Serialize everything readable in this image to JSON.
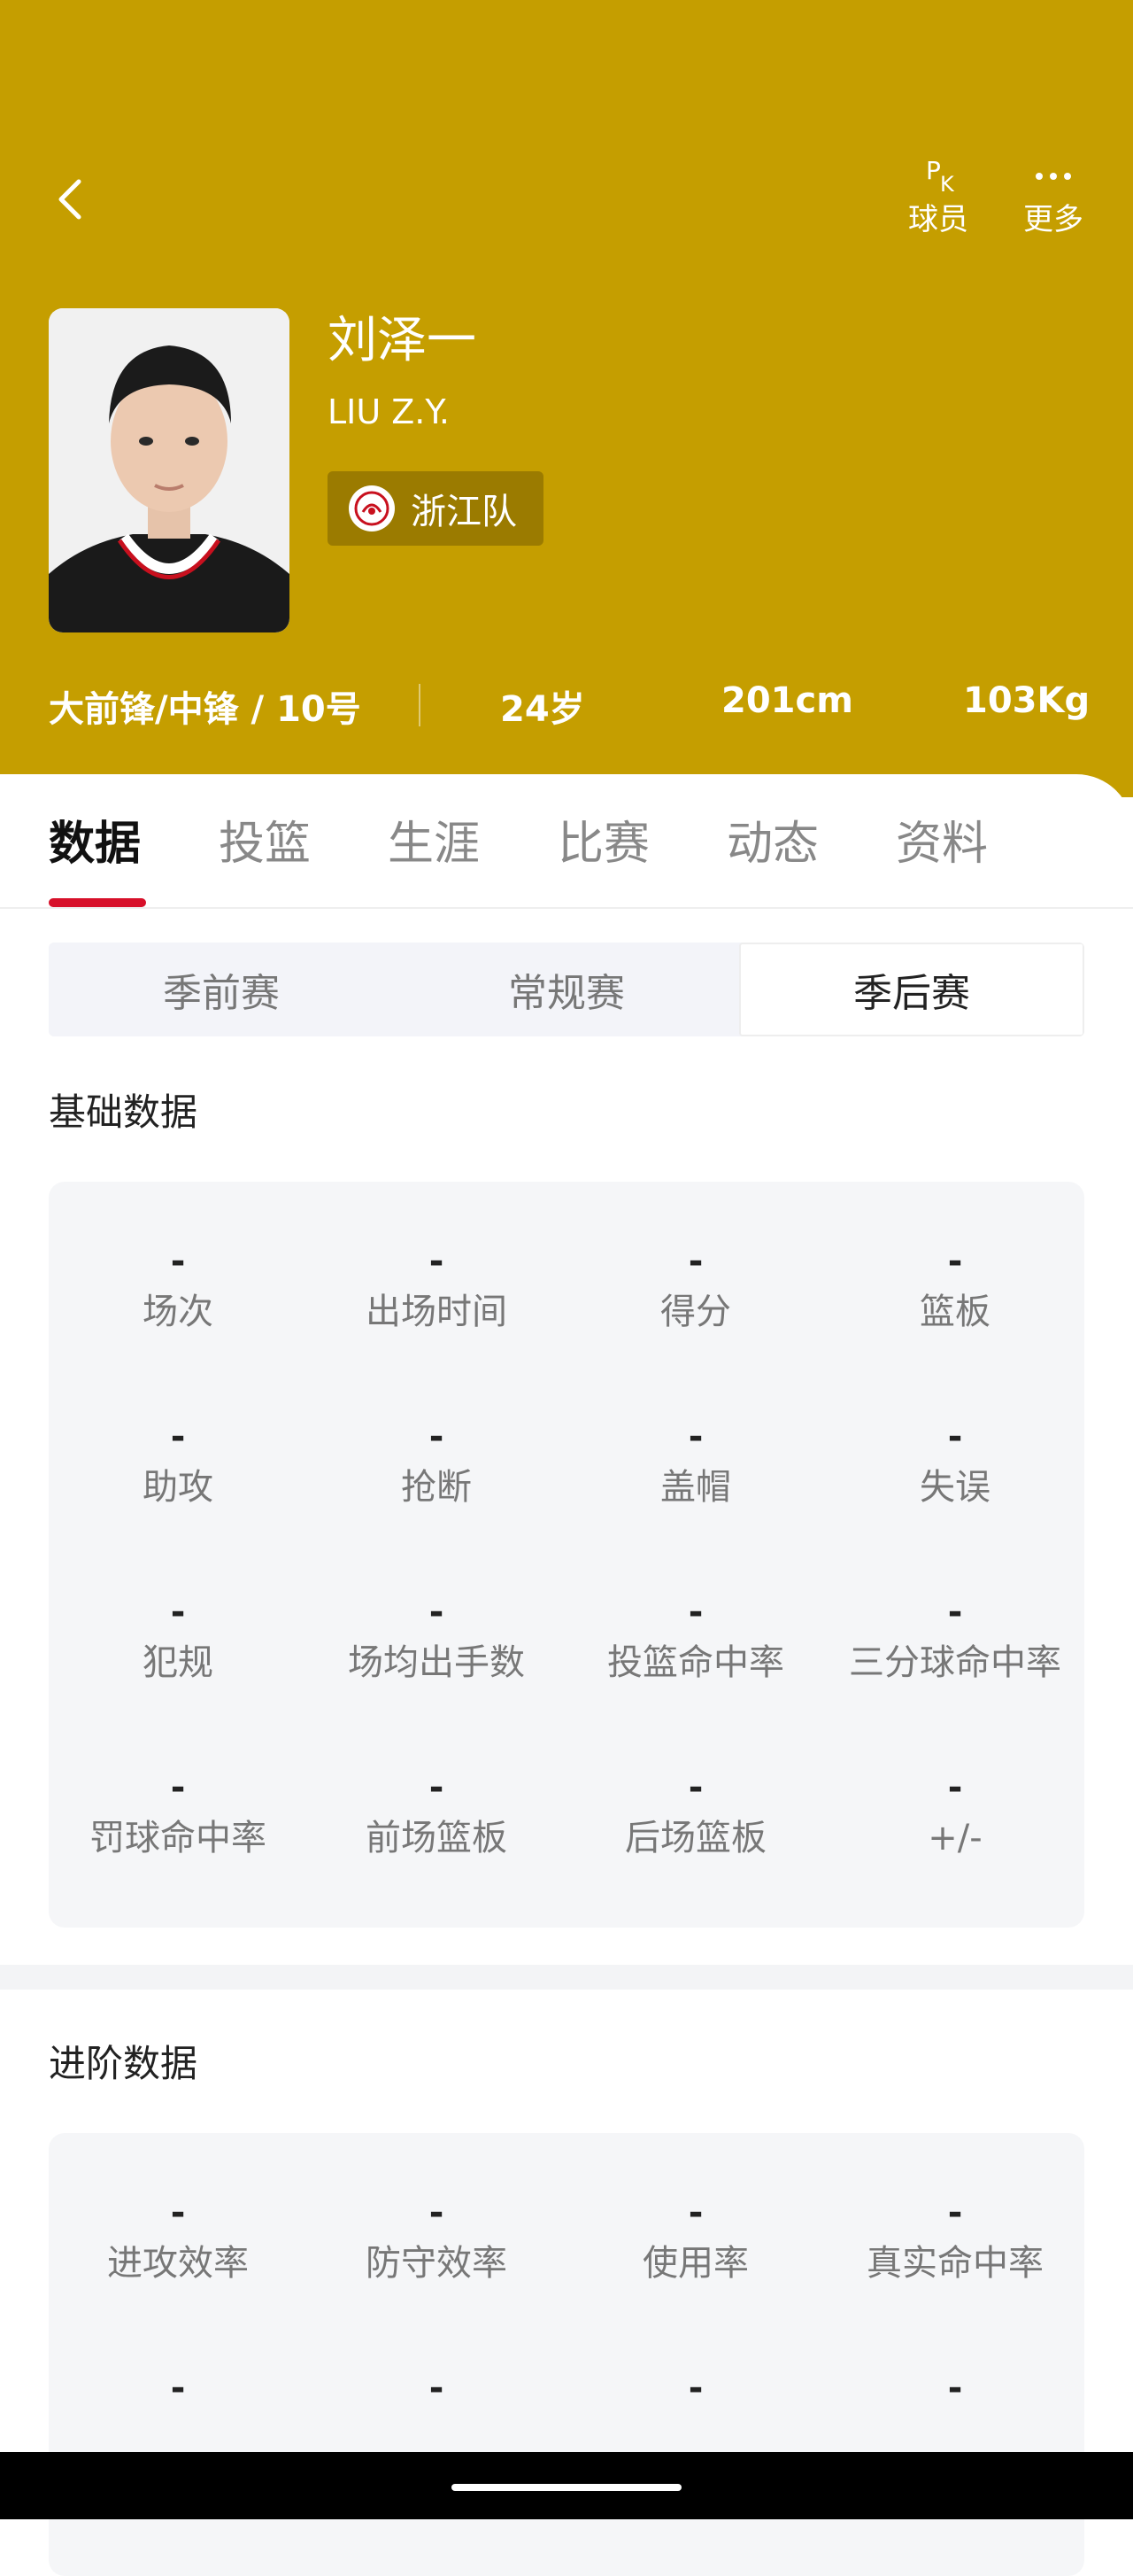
{
  "nav": {
    "pk_label": "球员",
    "more_label": "更多"
  },
  "player": {
    "name_cn": "刘泽一",
    "name_en": "LIU Z.Y.",
    "team": "浙江队",
    "position_number": "大前锋/中锋 / 10号",
    "age": "24岁",
    "height": "201cm",
    "weight": "103Kg"
  },
  "tabs": [
    {
      "label": "数据"
    },
    {
      "label": "投篮"
    },
    {
      "label": "生涯"
    },
    {
      "label": "比赛"
    },
    {
      "label": "动态"
    },
    {
      "label": "资料"
    }
  ],
  "season_types": [
    {
      "label": "季前赛"
    },
    {
      "label": "常规赛"
    },
    {
      "label": "季后赛"
    }
  ],
  "basic": {
    "title": "基础数据",
    "stats": [
      {
        "value": "-",
        "label": "场次"
      },
      {
        "value": "-",
        "label": "出场时间"
      },
      {
        "value": "-",
        "label": "得分"
      },
      {
        "value": "-",
        "label": "篮板"
      },
      {
        "value": "-",
        "label": "助攻"
      },
      {
        "value": "-",
        "label": "抢断"
      },
      {
        "value": "-",
        "label": "盖帽"
      },
      {
        "value": "-",
        "label": "失误"
      },
      {
        "value": "-",
        "label": "犯规"
      },
      {
        "value": "-",
        "label": "场均出手数"
      },
      {
        "value": "-",
        "label": "投篮命中率"
      },
      {
        "value": "-",
        "label": "三分球命中率"
      },
      {
        "value": "-",
        "label": "罚球命中率"
      },
      {
        "value": "-",
        "label": "前场篮板"
      },
      {
        "value": "-",
        "label": "后场篮板"
      },
      {
        "value": "-",
        "label": "+/-"
      }
    ]
  },
  "advanced": {
    "title": "进阶数据",
    "stats": [
      {
        "value": "-",
        "label": "进攻效率"
      },
      {
        "value": "-",
        "label": "防守效率"
      },
      {
        "value": "-",
        "label": "使用率"
      },
      {
        "value": "-",
        "label": "真实命中率"
      },
      {
        "value": "-",
        "label": ""
      },
      {
        "value": "-",
        "label": ""
      },
      {
        "value": "-",
        "label": ""
      },
      {
        "value": "-",
        "label": ""
      }
    ]
  }
}
